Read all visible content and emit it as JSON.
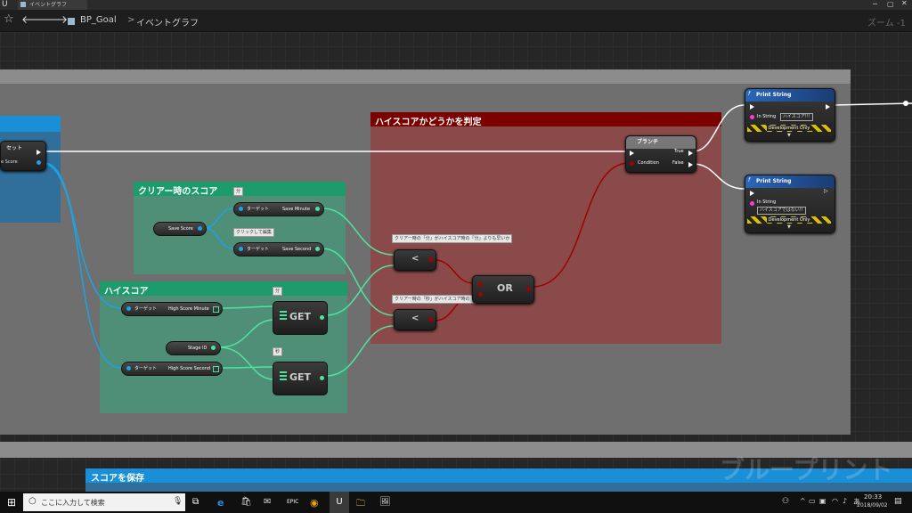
{
  "window": {
    "tab_title": "イベントグラフ",
    "breadcrumb_root": "BP_Goal",
    "breadcrumb_sep": ">",
    "breadcrumb_current": "イベントグラフ",
    "zoom": "ズーム -1",
    "watermark": "ブループリント"
  },
  "comments": {
    "left_blue": {
      "title": ""
    },
    "clear_score": {
      "title": "クリアー時のスコア",
      "badge": "分"
    },
    "high_score": {
      "title": "ハイスコア",
      "badge_min": "分",
      "badge_sec": "秒"
    },
    "judge": {
      "title": "ハイスコアかどうかを判定"
    },
    "save": {
      "title": "スコアを保存"
    }
  },
  "nodes": {
    "set_node": {
      "title": "セット",
      "pin": "e Score"
    },
    "save_score": {
      "label": "Save Score"
    },
    "save_minute": {
      "target": "ターゲット",
      "label": "Save Minute"
    },
    "save_second": {
      "target": "ターゲット",
      "label": "Save Second"
    },
    "edit_hint": "クリックして編集",
    "high_min": {
      "target": "ターゲット",
      "label": "High Score Minute"
    },
    "high_sec": {
      "target": "ターゲット",
      "label": "High Score Second"
    },
    "stage_id": {
      "label": "Stage ID"
    },
    "get1": "GET",
    "get2": "GET",
    "less1": "<",
    "less2": "<",
    "or_node": "OR",
    "note_min": "クリアー時の「分」がハイスコア時の「分」よりも早いか",
    "note_sec": "クリアー時の「秒」がハイスコア時の「秒」よりも早いか",
    "branch": {
      "title": "ブランチ",
      "true": "True",
      "condition": "Condition",
      "false": "False"
    },
    "print1": {
      "title": "Print String",
      "in_label": "In String",
      "value": "ハイスコア!!!",
      "dev": "Development Only"
    },
    "print2": {
      "title": "Print String",
      "in_label": "In String",
      "value": "ハイスコアではない!!",
      "dev": "Development Only"
    }
  },
  "taskbar": {
    "search_placeholder": "ここに入力して検索",
    "time": "20:33",
    "date": "2018/09/02",
    "epic": "EPIC"
  },
  "colors": {
    "grey_comment": "#6a6a6a",
    "teal_comment": "#2e9e74",
    "red_comment": "#7b1818",
    "blue_comment": "#1b7fbf"
  }
}
